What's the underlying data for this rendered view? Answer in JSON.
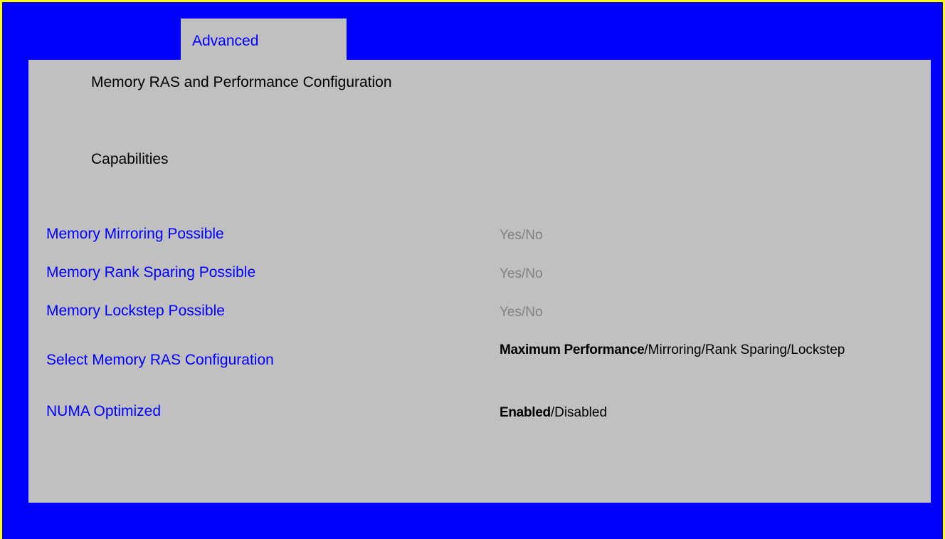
{
  "tab": {
    "label": "Advanced"
  },
  "panel": {
    "title": "Memory RAS and Performance Configuration",
    "section": "Capabilities"
  },
  "rows": [
    {
      "label": "Memory Mirroring Possible",
      "value": "Yes/No"
    },
    {
      "label": "Memory Rank Sparing Possible",
      "value": "Yes/No"
    },
    {
      "label": "Memory Lockstep Possible",
      "value": "Yes/No"
    },
    {
      "label": "Select Memory RAS Configuration",
      "value_selected": "Maximum Performance",
      "value_rest": "/Mirroring/Rank Sparing/Lockstep"
    },
    {
      "label": "NUMA Optimized",
      "value_selected": "Enabled",
      "value_rest": "/Disabled"
    }
  ],
  "colors": {
    "background": "#0000ff",
    "border": "#ffff00",
    "panel": "#c0c0c0",
    "label_text": "#0000ff",
    "readonly_value": "#808080",
    "value_text": "#000000"
  }
}
